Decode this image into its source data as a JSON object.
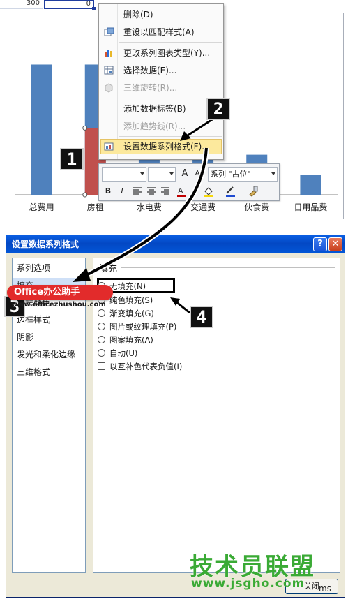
{
  "sheet": {
    "cell_value": "300",
    "active_cell_value": "0"
  },
  "chart_data": {
    "type": "bar",
    "categories": [
      "总费用",
      "房租",
      "水电费",
      "交通费",
      "伙食费",
      "日用品费"
    ],
    "series": [
      {
        "values": [
          1950,
          1950,
          1100,
          800,
          600,
          300
        ],
        "color": "#4f81bd"
      },
      {
        "values": [
          0,
          1000,
          0,
          0,
          0,
          0
        ],
        "color": "#c0504d"
      }
    ],
    "ylim": [
      0,
      2300
    ]
  },
  "context_menu": {
    "items": [
      {
        "label": "删除(D)",
        "icon": "delete-icon",
        "disabled": false
      },
      {
        "label": "重设以匹配样式(A)",
        "icon": "reset-style-icon",
        "disabled": false
      },
      {
        "label": "更改系列图表类型(Y)...",
        "icon": "chart-type-icon",
        "disabled": false
      },
      {
        "label": "选择数据(E)...",
        "icon": "select-data-icon",
        "disabled": false
      },
      {
        "label": "三维旋转(R)...",
        "icon": "rotate-3d-icon",
        "disabled": true
      },
      {
        "label": "添加数据标签(B)",
        "icon": "",
        "disabled": false
      },
      {
        "label": "添加趋势线(R)...",
        "icon": "",
        "disabled": true
      },
      {
        "label": "设置数据系列格式(F)...",
        "icon": "format-series-icon",
        "disabled": false
      }
    ]
  },
  "mini_toolbar": {
    "series_value": "系列 \"占位\"",
    "buttons": {
      "bold": "B",
      "italic": "I",
      "grow": "A",
      "shrink": "A"
    }
  },
  "badges": {
    "b1": "1",
    "b2": "2",
    "b3": "3",
    "b4": "4"
  },
  "dialog": {
    "title": "设置数据系列格式",
    "help": "?",
    "close_x": "✕",
    "nav": [
      "系列选项",
      "填充",
      "边框颜色",
      "边框样式",
      "阴影",
      "发光和柔化边缘",
      "三维格式"
    ],
    "section_title": "填充",
    "options": [
      {
        "label": "无填充(N)",
        "type": "radio"
      },
      {
        "label": "纯色填充(S)",
        "type": "radio"
      },
      {
        "label": "渐变填充(G)",
        "type": "radio"
      },
      {
        "label": "图片或纹理填充(P)",
        "type": "radio"
      },
      {
        "label": "图案填充(A)",
        "type": "radio"
      },
      {
        "label": "自动(U)",
        "type": "radio"
      },
      {
        "label": "以互补色代表负值(I)",
        "type": "checkbox"
      }
    ],
    "close_button": "关闭",
    "partial_text": "ms"
  },
  "watermarks": {
    "office_badge": "Office办公助手",
    "office_url": "www.officezhushou.com",
    "brand": "技术员联盟",
    "brand_url": "www.jsgho.com"
  },
  "colors": {
    "accent": "#0a5ee2",
    "bar_blue": "#4f81bd",
    "bar_red": "#c0504d",
    "highlight": "#fce99d",
    "watermark_green": "#3aaa35"
  }
}
